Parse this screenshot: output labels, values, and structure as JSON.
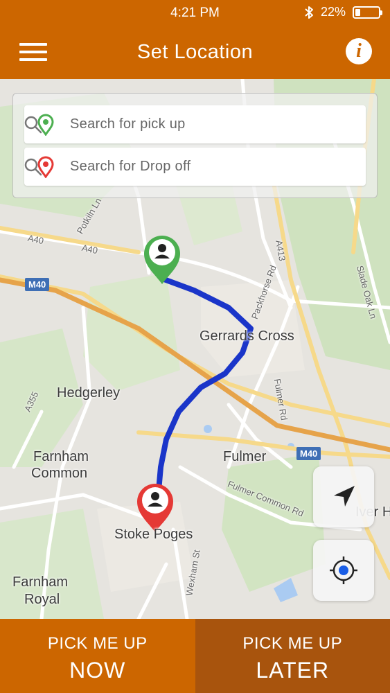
{
  "status_bar": {
    "time": "4:21 PM",
    "battery_percent": "22%",
    "battery_level": 0.22,
    "icons": [
      "bluetooth-icon",
      "battery-icon"
    ]
  },
  "header": {
    "title": "Set Location",
    "menu_icon": "hamburger-menu-icon",
    "info_icon": "info-icon",
    "info_glyph": "i"
  },
  "search": {
    "pickup_placeholder": "Search for pick up",
    "dropoff_placeholder": "Search for Drop off",
    "pickup_pin_color": "#4caf50",
    "dropoff_pin_color": "#e53935"
  },
  "map": {
    "labels": {
      "gerrards_cross": "Gerrards Cross",
      "hedgerley": "Hedgerley",
      "farnham_common_1": "Farnham",
      "farnham_common_2": "Common",
      "fulmer": "Fulmer",
      "stoke_poges": "Stoke Poges",
      "farnham_royal_1": "Farnham",
      "farnham_royal_2": "Royal",
      "m40_west": "M40",
      "m40_east": "M40",
      "a40_1": "A40",
      "a40_2": "A40",
      "a413": "A413",
      "a355": "A355",
      "packhorse_rd": "Packhorse Rd",
      "fulmer_rd": "Fulmer Rd",
      "fulmer_common_rd": "Fulmer Common Rd",
      "wexham_st": "Wexham St",
      "slade_oak_ln": "Slade Oak Ln",
      "potkiln_ln": "Potkiln Ln",
      "iver_h": "Iver H"
    },
    "route_color": "#1a35c9"
  },
  "controls": {
    "navigate_icon": "navigation-arrow-icon",
    "locate_icon": "my-location-crosshair-icon"
  },
  "bottom": {
    "now_top": "PICK ME UP",
    "now_big": "NOW",
    "later_top": "PICK ME UP",
    "later_big": "LATER"
  },
  "colors": {
    "brand": "#cc6600",
    "brand_dark": "#a8540d"
  }
}
